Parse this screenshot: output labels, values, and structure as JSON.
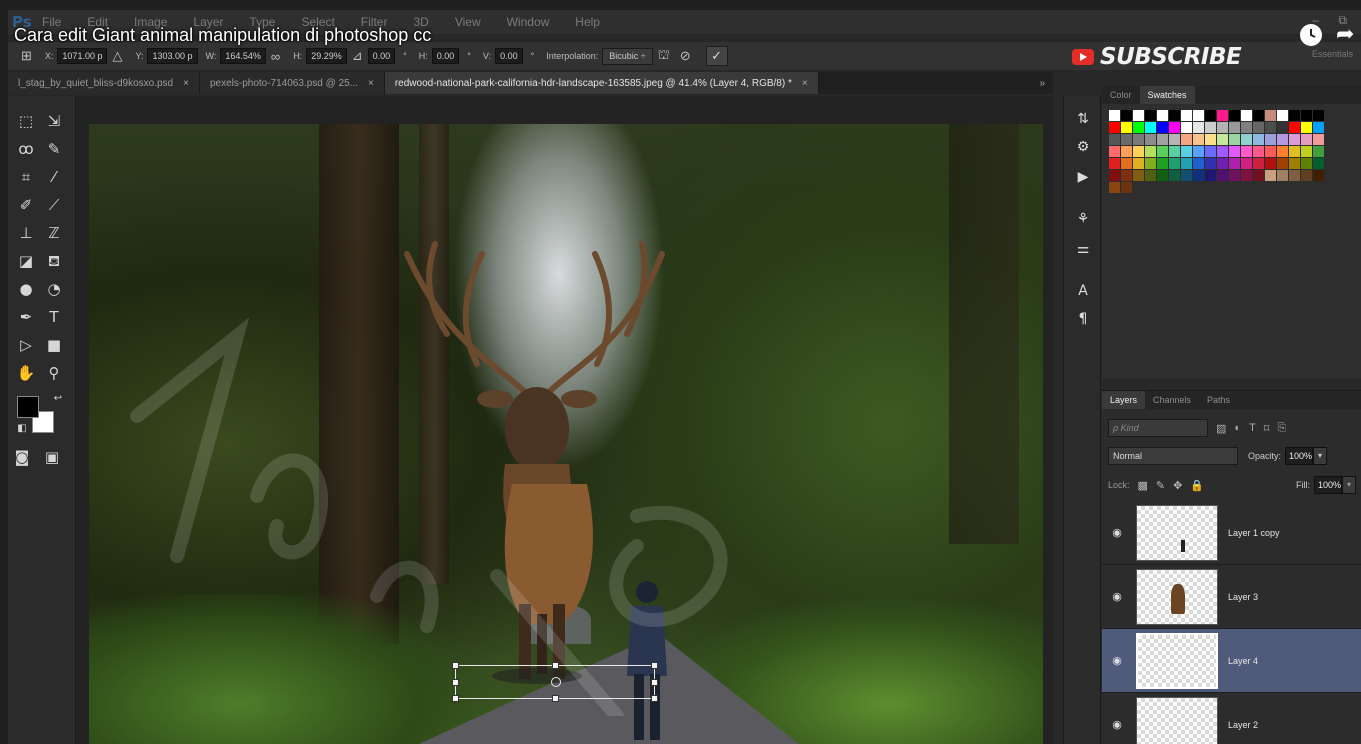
{
  "video": {
    "title": "Cara edit Giant animal manipulation di photoshop cc",
    "subscribe_label": "SUBSCRIBE"
  },
  "menubar": {
    "logo": "Ps",
    "items": [
      "File",
      "Edit",
      "Image",
      "Layer",
      "Type",
      "Select",
      "Filter",
      "3D",
      "View",
      "Window",
      "Help"
    ]
  },
  "options": {
    "x_label": "X:",
    "x_value": "1071.00 p",
    "y_label": "Y:",
    "y_value": "1303.00 p",
    "w_label": "W:",
    "w_value": "164.54%",
    "h_label": "H:",
    "h_value": "29.29%",
    "angle_value": "0.00",
    "hskew_label": "H:",
    "hskew_value": "0.00",
    "vskew_label": "V:",
    "vskew_value": "0.00",
    "degree_symbol": "°",
    "interp_label": "Interpolation:",
    "interp_value": "Bicubic",
    "workspace": "Essentials"
  },
  "tabs": [
    {
      "label": "l_stag_by_quiet_bliss-d9kosxo.psd",
      "close": "×"
    },
    {
      "label": "pexels-photo-714063.psd @ 25...",
      "close": "×"
    },
    {
      "label": "redwood-national-park-california-hdr-landscape-163585.jpeg @ 41.4% (Layer 4, RGB/8) *",
      "close": "×"
    }
  ],
  "tab_overflow": "»",
  "swatch_panel": {
    "tabs": [
      "Color",
      "Swatches"
    ],
    "active_tab": "Swatches",
    "rows": [
      [
        "#ffffff",
        "#000000",
        "#ffffff",
        "#000000",
        "#ffffff",
        "#000000",
        "#ffffff",
        "#ffffff",
        "#000000",
        "#ff1a8c",
        "#000000",
        "#ffffff",
        "#000000",
        "#c48a7a",
        "#ffffff",
        "#000000",
        "#000000",
        "#000000"
      ],
      [
        "#ff0000",
        "#ffff00",
        "#00ff00",
        "#00ffff",
        "#0000ff",
        "#ff00ff",
        "#ffffff",
        "#e6e6e6",
        "#cccccc",
        "#b3b3b3",
        "#999999",
        "#808080",
        "#666666",
        "#4d4d4d",
        "#333333",
        "#ff0000",
        "#ffff00",
        "#00a0ff"
      ],
      [
        "#555555",
        "#6b6b6b",
        "#7a7a7a",
        "#8c8c8c",
        "#a0a0a0",
        "#b4b4b4",
        "#f4a582",
        "#f7c58a",
        "#fde08b",
        "#c7e89a",
        "#9ad4a0",
        "#8fd0d0",
        "#8fb8e0",
        "#9aa0dc",
        "#b39ae0",
        "#d89ad8",
        "#e69ac0",
        "#f09a9a"
      ],
      [
        "#ff6b6b",
        "#ff9f5a",
        "#ffd25a",
        "#b5e05a",
        "#5ad05a",
        "#5ad0a0",
        "#5ad0e0",
        "#5aa0ff",
        "#6a6aff",
        "#a05aff",
        "#e05aff",
        "#ff5ac8",
        "#ff5a8a",
        "#ff5a5a",
        "#ff7f2a",
        "#e0c020",
        "#c0d020",
        "#40a040"
      ],
      [
        "#e02020",
        "#e07020",
        "#e0b020",
        "#80b020",
        "#20a020",
        "#20a070",
        "#20a0b0",
        "#2060d0",
        "#3030b0",
        "#7020b0",
        "#b020b0",
        "#d02080",
        "#d02040",
        "#b01010",
        "#a04000",
        "#a08000",
        "#608000",
        "#006030"
      ],
      [
        "#801010",
        "#803010",
        "#806010",
        "#506010",
        "#106010",
        "#106040",
        "#105070",
        "#103080",
        "#201870",
        "#501070",
        "#701060",
        "#801040",
        "#701020",
        "#c8a080",
        "#a08060",
        "#806040",
        "#604020",
        "#402000"
      ],
      [
        "#8b4513",
        "#6b3310"
      ]
    ]
  },
  "layers_panel": {
    "tabs": [
      "Layers",
      "Channels",
      "Paths"
    ],
    "active_tab": "Layers",
    "kind_placeholder": "ρ Kind",
    "blend_mode": "Normal",
    "opacity_label": "Opacity:",
    "opacity_value": "100%",
    "lock_label": "Lock:",
    "fill_label": "Fill:",
    "fill_value": "100%",
    "layers": [
      {
        "name": "Layer 1 copy",
        "active": false
      },
      {
        "name": "Layer 3",
        "active": false
      },
      {
        "name": "Layer 4",
        "active": true
      },
      {
        "name": "Layer 2",
        "active": false
      }
    ]
  }
}
